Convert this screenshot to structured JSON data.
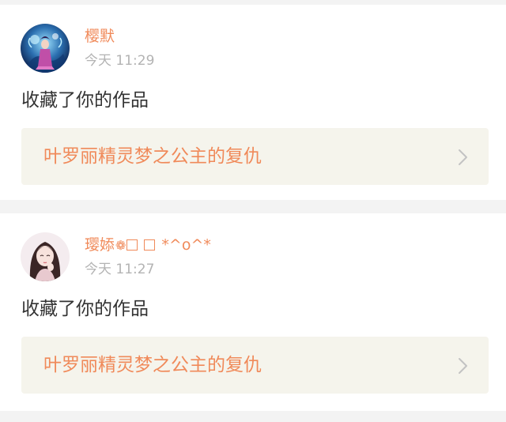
{
  "feed": {
    "items": [
      {
        "username": "樱默",
        "time": "今天 11:29",
        "action": "收藏了你的作品",
        "work_title": "叶罗丽精灵梦之公主的复仇"
      },
      {
        "username_text": "璎婖",
        "username_flower": "❁",
        "username_suffix": "*^o^*",
        "time": "今天 11:27",
        "action": "收藏了你的作品",
        "work_title": "叶罗丽精灵梦之公主的复仇"
      }
    ]
  },
  "colors": {
    "accent": "#f08a5a",
    "timestamp": "#b3b3b3",
    "body_text": "#333333",
    "link_card_bg": "#f5f4ec",
    "page_bg": "#f3f3f3"
  },
  "icons": {
    "chevron": "chevron-right-icon"
  }
}
